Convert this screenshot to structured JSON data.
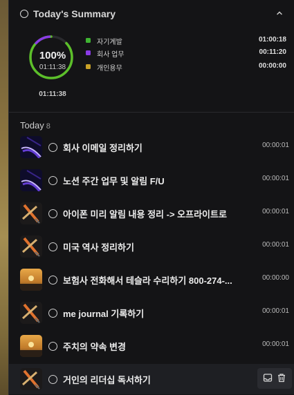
{
  "summary": {
    "title": "Today's Summary",
    "percent": "100%",
    "elapsed": "01:11:38",
    "total": "01:11:38",
    "ring_progress": 1.0,
    "legend": [
      {
        "label": "자기계발",
        "time": "01:00:18",
        "color": "#3fb532"
      },
      {
        "label": "회사 업무",
        "time": "00:11:20",
        "color": "#8a3be6"
      },
      {
        "label": "개인용무",
        "time": "00:00:00",
        "color": "#c9a227"
      }
    ],
    "ring_colors": {
      "main": "#5cbf2a",
      "secondary": "#8a3be6"
    }
  },
  "today": {
    "label": "Today",
    "count": "8",
    "tasks": [
      {
        "title": "회사 이메일 정리하기",
        "time": "00:00:01",
        "thumb": "purple-light-icon"
      },
      {
        "title": "노션 주간 업무 및 알림 F/U",
        "time": "00:00:01",
        "thumb": "purple-light-icon"
      },
      {
        "title": "아이폰 미리 알림 내용 정리 -> 오프라이트로",
        "time": "00:00:01",
        "thumb": "pencil-icon"
      },
      {
        "title": "미국 역사 정리하기",
        "time": "00:00:01",
        "thumb": "pencil-icon"
      },
      {
        "title": "보험사 전화해서 테슬라 수리하기 800-274-...",
        "time": "00:00:00",
        "thumb": "sunset-icon"
      },
      {
        "title": "me journal 기록하기",
        "time": "00:00:01",
        "thumb": "pencil-icon"
      },
      {
        "title": "주치의 약속 변경",
        "time": "00:00:01",
        "thumb": "sunset-icon"
      },
      {
        "title": "거인의 리더십 독서하기",
        "time": "",
        "thumb": "pencil-icon"
      }
    ]
  }
}
